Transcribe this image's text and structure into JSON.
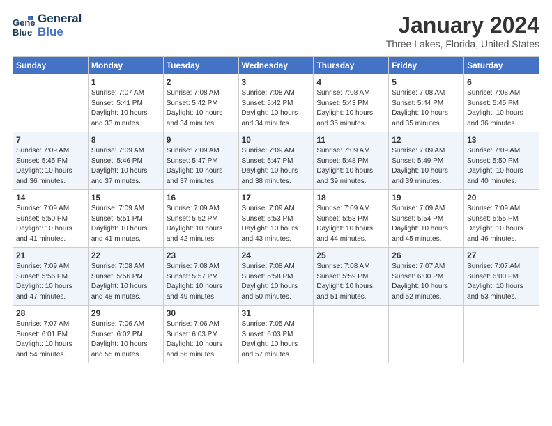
{
  "logo": {
    "line1": "General",
    "line2": "Blue"
  },
  "title": "January 2024",
  "location": "Three Lakes, Florida, United States",
  "days_header": [
    "Sunday",
    "Monday",
    "Tuesday",
    "Wednesday",
    "Thursday",
    "Friday",
    "Saturday"
  ],
  "weeks": [
    [
      {
        "num": "",
        "sunrise": "",
        "sunset": "",
        "daylight": ""
      },
      {
        "num": "1",
        "sunrise": "Sunrise: 7:07 AM",
        "sunset": "Sunset: 5:41 PM",
        "daylight": "Daylight: 10 hours and 33 minutes."
      },
      {
        "num": "2",
        "sunrise": "Sunrise: 7:08 AM",
        "sunset": "Sunset: 5:42 PM",
        "daylight": "Daylight: 10 hours and 34 minutes."
      },
      {
        "num": "3",
        "sunrise": "Sunrise: 7:08 AM",
        "sunset": "Sunset: 5:42 PM",
        "daylight": "Daylight: 10 hours and 34 minutes."
      },
      {
        "num": "4",
        "sunrise": "Sunrise: 7:08 AM",
        "sunset": "Sunset: 5:43 PM",
        "daylight": "Daylight: 10 hours and 35 minutes."
      },
      {
        "num": "5",
        "sunrise": "Sunrise: 7:08 AM",
        "sunset": "Sunset: 5:44 PM",
        "daylight": "Daylight: 10 hours and 35 minutes."
      },
      {
        "num": "6",
        "sunrise": "Sunrise: 7:08 AM",
        "sunset": "Sunset: 5:45 PM",
        "daylight": "Daylight: 10 hours and 36 minutes."
      }
    ],
    [
      {
        "num": "7",
        "sunrise": "Sunrise: 7:09 AM",
        "sunset": "Sunset: 5:45 PM",
        "daylight": "Daylight: 10 hours and 36 minutes."
      },
      {
        "num": "8",
        "sunrise": "Sunrise: 7:09 AM",
        "sunset": "Sunset: 5:46 PM",
        "daylight": "Daylight: 10 hours and 37 minutes."
      },
      {
        "num": "9",
        "sunrise": "Sunrise: 7:09 AM",
        "sunset": "Sunset: 5:47 PM",
        "daylight": "Daylight: 10 hours and 37 minutes."
      },
      {
        "num": "10",
        "sunrise": "Sunrise: 7:09 AM",
        "sunset": "Sunset: 5:47 PM",
        "daylight": "Daylight: 10 hours and 38 minutes."
      },
      {
        "num": "11",
        "sunrise": "Sunrise: 7:09 AM",
        "sunset": "Sunset: 5:48 PM",
        "daylight": "Daylight: 10 hours and 39 minutes."
      },
      {
        "num": "12",
        "sunrise": "Sunrise: 7:09 AM",
        "sunset": "Sunset: 5:49 PM",
        "daylight": "Daylight: 10 hours and 39 minutes."
      },
      {
        "num": "13",
        "sunrise": "Sunrise: 7:09 AM",
        "sunset": "Sunset: 5:50 PM",
        "daylight": "Daylight: 10 hours and 40 minutes."
      }
    ],
    [
      {
        "num": "14",
        "sunrise": "Sunrise: 7:09 AM",
        "sunset": "Sunset: 5:50 PM",
        "daylight": "Daylight: 10 hours and 41 minutes."
      },
      {
        "num": "15",
        "sunrise": "Sunrise: 7:09 AM",
        "sunset": "Sunset: 5:51 PM",
        "daylight": "Daylight: 10 hours and 41 minutes."
      },
      {
        "num": "16",
        "sunrise": "Sunrise: 7:09 AM",
        "sunset": "Sunset: 5:52 PM",
        "daylight": "Daylight: 10 hours and 42 minutes."
      },
      {
        "num": "17",
        "sunrise": "Sunrise: 7:09 AM",
        "sunset": "Sunset: 5:53 PM",
        "daylight": "Daylight: 10 hours and 43 minutes."
      },
      {
        "num": "18",
        "sunrise": "Sunrise: 7:09 AM",
        "sunset": "Sunset: 5:53 PM",
        "daylight": "Daylight: 10 hours and 44 minutes."
      },
      {
        "num": "19",
        "sunrise": "Sunrise: 7:09 AM",
        "sunset": "Sunset: 5:54 PM",
        "daylight": "Daylight: 10 hours and 45 minutes."
      },
      {
        "num": "20",
        "sunrise": "Sunrise: 7:09 AM",
        "sunset": "Sunset: 5:55 PM",
        "daylight": "Daylight: 10 hours and 46 minutes."
      }
    ],
    [
      {
        "num": "21",
        "sunrise": "Sunrise: 7:09 AM",
        "sunset": "Sunset: 5:56 PM",
        "daylight": "Daylight: 10 hours and 47 minutes."
      },
      {
        "num": "22",
        "sunrise": "Sunrise: 7:08 AM",
        "sunset": "Sunset: 5:56 PM",
        "daylight": "Daylight: 10 hours and 48 minutes."
      },
      {
        "num": "23",
        "sunrise": "Sunrise: 7:08 AM",
        "sunset": "Sunset: 5:57 PM",
        "daylight": "Daylight: 10 hours and 49 minutes."
      },
      {
        "num": "24",
        "sunrise": "Sunrise: 7:08 AM",
        "sunset": "Sunset: 5:58 PM",
        "daylight": "Daylight: 10 hours and 50 minutes."
      },
      {
        "num": "25",
        "sunrise": "Sunrise: 7:08 AM",
        "sunset": "Sunset: 5:59 PM",
        "daylight": "Daylight: 10 hours and 51 minutes."
      },
      {
        "num": "26",
        "sunrise": "Sunrise: 7:07 AM",
        "sunset": "Sunset: 6:00 PM",
        "daylight": "Daylight: 10 hours and 52 minutes."
      },
      {
        "num": "27",
        "sunrise": "Sunrise: 7:07 AM",
        "sunset": "Sunset: 6:00 PM",
        "daylight": "Daylight: 10 hours and 53 minutes."
      }
    ],
    [
      {
        "num": "28",
        "sunrise": "Sunrise: 7:07 AM",
        "sunset": "Sunset: 6:01 PM",
        "daylight": "Daylight: 10 hours and 54 minutes."
      },
      {
        "num": "29",
        "sunrise": "Sunrise: 7:06 AM",
        "sunset": "Sunset: 6:02 PM",
        "daylight": "Daylight: 10 hours and 55 minutes."
      },
      {
        "num": "30",
        "sunrise": "Sunrise: 7:06 AM",
        "sunset": "Sunset: 6:03 PM",
        "daylight": "Daylight: 10 hours and 56 minutes."
      },
      {
        "num": "31",
        "sunrise": "Sunrise: 7:05 AM",
        "sunset": "Sunset: 6:03 PM",
        "daylight": "Daylight: 10 hours and 57 minutes."
      },
      {
        "num": "",
        "sunrise": "",
        "sunset": "",
        "daylight": ""
      },
      {
        "num": "",
        "sunrise": "",
        "sunset": "",
        "daylight": ""
      },
      {
        "num": "",
        "sunrise": "",
        "sunset": "",
        "daylight": ""
      }
    ]
  ]
}
